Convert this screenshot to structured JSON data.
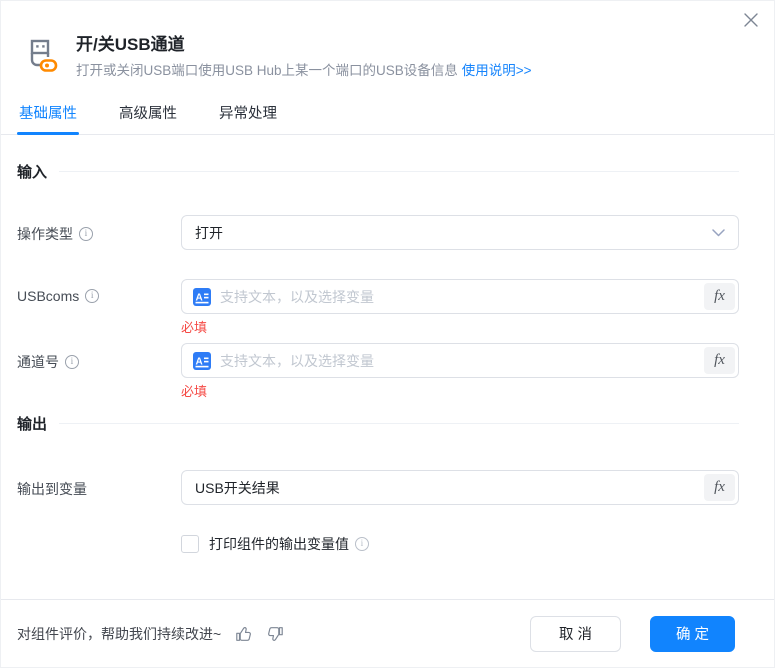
{
  "dialog": {
    "header": {
      "title": "开/关USB通道",
      "description": "打开或关闭USB端口使用USB Hub上某一个端口的USB设备信息",
      "help_link": "使用说明>>"
    },
    "tabs": [
      {
        "label": "基础属性",
        "active": true
      },
      {
        "label": "高级属性",
        "active": false
      },
      {
        "label": "异常处理",
        "active": false
      }
    ],
    "sections": {
      "input": "输入",
      "output": "输出"
    },
    "fields": {
      "operation_type": {
        "label": "操作类型",
        "value": "打开"
      },
      "usbcoms": {
        "label": "USBcoms",
        "placeholder": "支持文本，以及选择变量",
        "value": "",
        "required_text": "必填"
      },
      "channel": {
        "label": "通道号",
        "placeholder": "支持文本，以及选择变量",
        "value": "",
        "required_text": "必填"
      },
      "output_var": {
        "label": "输出到变量",
        "value": "USB开关结果"
      }
    },
    "fx_label": "fx",
    "checkbox": {
      "label": "打印组件的输出变量值",
      "checked": false
    },
    "footer": {
      "feedback_text": "对组件评价，帮助我们持续改进~",
      "cancel_label": "取 消",
      "confirm_label": "确 定"
    },
    "colors": {
      "accent": "#1184fe",
      "link": "#1684fc",
      "required": "#f54a45",
      "icon_orange": "#ff8a00",
      "icon_gray": "#747d8c"
    }
  }
}
